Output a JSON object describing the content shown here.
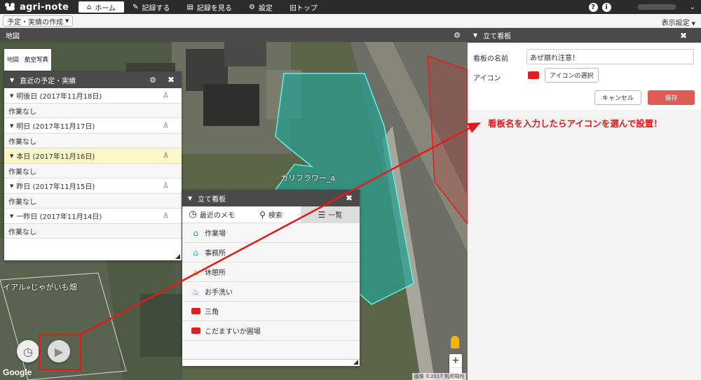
{
  "app": {
    "name": "agri-note"
  },
  "nav": {
    "items": [
      {
        "label": "ホーム",
        "icon": "home-icon"
      },
      {
        "label": "記録する",
        "icon": "pencil-icon"
      },
      {
        "label": "記録を見る",
        "icon": "notebook-icon"
      },
      {
        "label": "設定",
        "icon": "gear-icon"
      },
      {
        "label": "旧トップ",
        "icon": ""
      }
    ]
  },
  "subbar": {
    "create_label": "予定・実績の作成",
    "display_settings": "表示設定"
  },
  "map": {
    "title": "地図",
    "type_tabs": [
      "地図",
      "航空写真"
    ],
    "field_label": "カリフラワー_a",
    "field_label2": "イアル»じゃがいも畑",
    "google": "Google",
    "attribution": "画像 ©2017  利用規約",
    "zoom_in": "+",
    "zoom_out": "−"
  },
  "schedule_panel": {
    "title": "直近の予定・実績",
    "days": [
      {
        "label": "明後日 (2017年11月18日)",
        "content": "作業なし",
        "highlight": false
      },
      {
        "label": "明日 (2017年11月17日)",
        "content": "作業なし",
        "highlight": false
      },
      {
        "label": "本日 (2017年11月16日)",
        "content": "作業なし",
        "highlight": true
      },
      {
        "label": "昨日 (2017年11月15日)",
        "content": "作業なし",
        "highlight": false
      },
      {
        "label": "一昨日 (2017年11月14日)",
        "content": "作業なし",
        "highlight": false
      }
    ]
  },
  "signboard_panel": {
    "title": "立て看板",
    "tabs": [
      "最近のメモ",
      "検索",
      "一覧"
    ],
    "items": [
      {
        "label": "作業場",
        "icon": "barn-icon",
        "color": "#3c8ad6"
      },
      {
        "label": "事務所",
        "icon": "house-icon",
        "color": "#3ca8d6"
      },
      {
        "label": "休憩所",
        "icon": "house-icon",
        "color": "#f0a020"
      },
      {
        "label": "お手洗い",
        "icon": "toilet-icon",
        "color": "#3c8ad6"
      },
      {
        "label": "三角",
        "icon": "sign-icon",
        "color": "#e02020"
      },
      {
        "label": "こだますいか圃場",
        "icon": "sign-icon",
        "color": "#e02020"
      }
    ]
  },
  "side_panel": {
    "title": "立て看板",
    "name_label": "看板の名前",
    "name_value": "あぜ崩れ注意！",
    "icon_label": "アイコン",
    "icon_select_label": "アイコンの選択",
    "cancel_label": "キャンセル",
    "save_label": "保存"
  },
  "annotation": "看板名を入力したらアイコンを選んで設置！",
  "colors": {
    "accent_red": "#e31b1b",
    "save": "#df5b56",
    "field_fill": "#2a9d8f",
    "field_border": "#5ff2e8",
    "dark_bar": "#4a4a4a"
  }
}
